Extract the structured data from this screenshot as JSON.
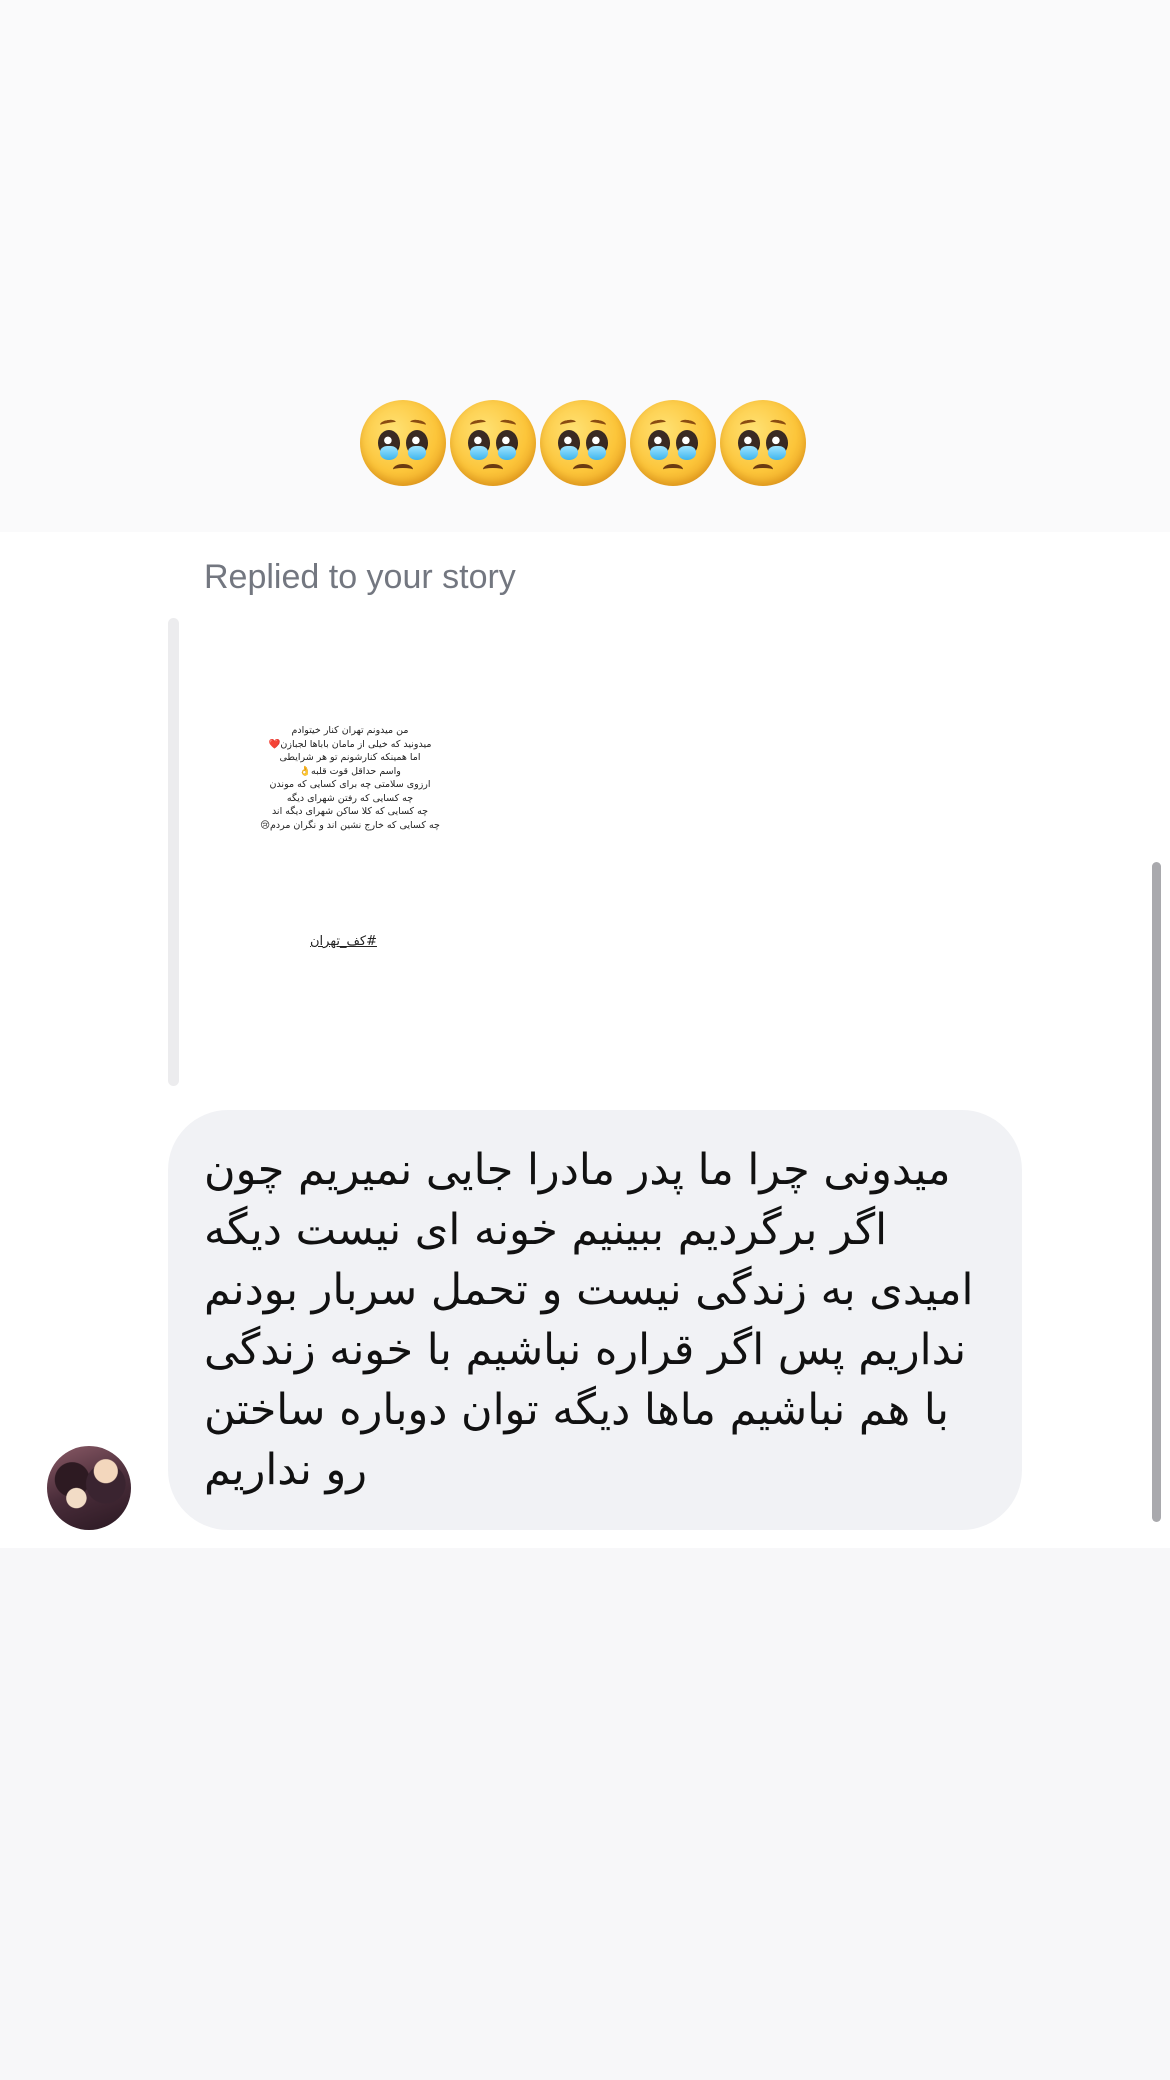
{
  "reaction": {
    "emojis": [
      "🥺",
      "🥺",
      "🥺",
      "🥺",
      "🥺"
    ],
    "emoji_name": "pleading-face-icon"
  },
  "reply": {
    "label": "Replied to your story"
  },
  "story": {
    "lines": [
      "من میدونم تهران کنار خیتوادم",
      "میدونید که خیلی از مامان باباها لجبازن❤️",
      "اما همینکه کنارشونم تو هر شرایطی",
      "واسم حداقل قوت قلبه👌",
      "ارزوی سلامتی چه برای کسایی که موندن",
      "چه کسایی که رفتن شهرای دیگه",
      "چه کسایی که کلا ساکن شهرای دیگه اند",
      "چه کسایی که خارج نشین اند و نگران مردم😢"
    ],
    "hashtag": "#کف_تهران"
  },
  "message": {
    "text": "میدونی چرا ما پدر مادرا جایی نمیریم چون اگر برگردیم ببینیم خونه ای نیست دیگه امیدی به زندگی نیست و تحمل سربار بودنم نداریم پس اگر قراره نباشیم با خونه زندگی با هم نباشیم ماها دیگه توان دوباره ساختن رو نداریم"
  },
  "colors": {
    "bubble": "#f1f2f5",
    "label": "#737780",
    "background": "#ffffff"
  }
}
